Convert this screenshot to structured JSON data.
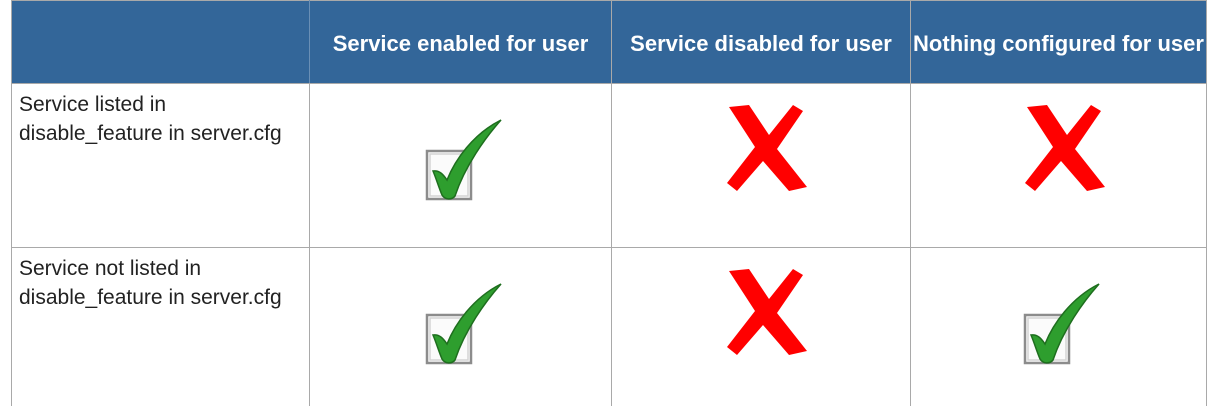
{
  "table": {
    "headers": [
      "",
      "Service enabled for user",
      "Service disabled for user",
      "Nothing configured for user"
    ],
    "rows": [
      {
        "label": "Service listed in disable_feature in server.cfg",
        "cells": [
          "check",
          "cross",
          "cross"
        ]
      },
      {
        "label": "Service not listed in disable_feature in server.cfg",
        "cells": [
          "check",
          "cross",
          "check"
        ]
      }
    ]
  },
  "icons": {
    "check": "checked-box-icon",
    "cross": "red-x-icon"
  },
  "colors": {
    "header_background": "#336699",
    "header_text": "#ffffff",
    "check_green": "#2e9e2e",
    "cross_red": "#ff0000",
    "grid": "#a9a9a9"
  }
}
